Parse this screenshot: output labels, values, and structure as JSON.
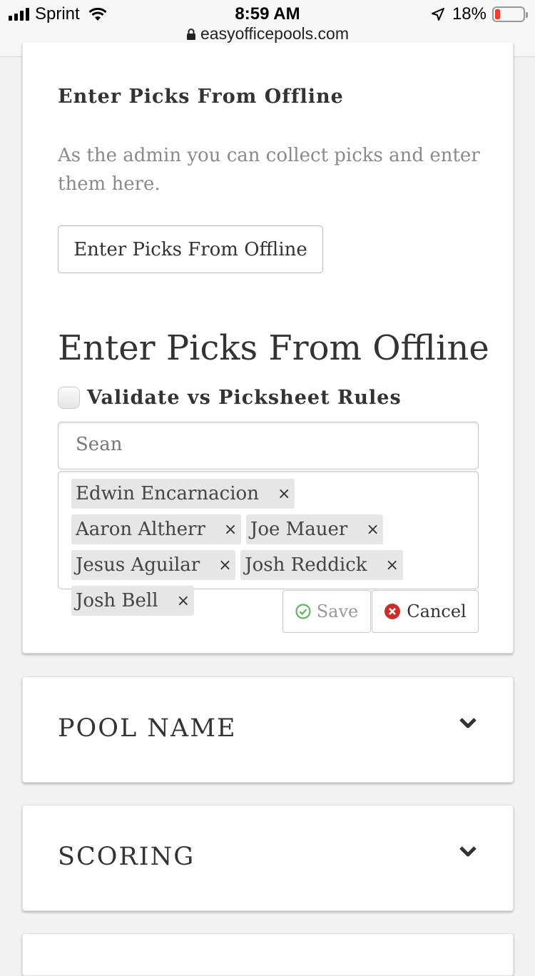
{
  "status_bar": {
    "carrier": "Sprint",
    "time": "8:59 AM",
    "url": "easyofficepools.com",
    "battery": "18%",
    "battery_level": 0.18,
    "battery_color": "#ff3b30"
  },
  "offline_section": {
    "subtitle": "Enter Picks From Offline",
    "description": "As the admin you can collect picks and enter them here.",
    "button_label": "Enter Picks From Offline",
    "form_title": "Enter Picks From Offline",
    "validate_label": "Validate vs Picksheet Rules",
    "validate_checked": false,
    "name_value": "Sean",
    "selected_players": [
      {
        "name": "Edwin Encarnacion",
        "remove": "×"
      },
      {
        "name": "Aaron Altherr",
        "remove": "×"
      },
      {
        "name": "Joe Mauer",
        "remove": "×"
      },
      {
        "name": "Jesus Aguilar",
        "remove": "×"
      },
      {
        "name": "Josh Reddick",
        "remove": "×"
      },
      {
        "name": "Josh Bell",
        "remove": "×"
      }
    ],
    "save_label": "Save",
    "cancel_label": "Cancel",
    "save_icon_color": "#5cb85c",
    "cancel_icon_color": "#c9302c"
  },
  "sections": [
    {
      "title": "POOL NAME",
      "icon": "chevron-down-icon"
    },
    {
      "title": "SCORING",
      "icon": "chevron-down-icon"
    }
  ]
}
